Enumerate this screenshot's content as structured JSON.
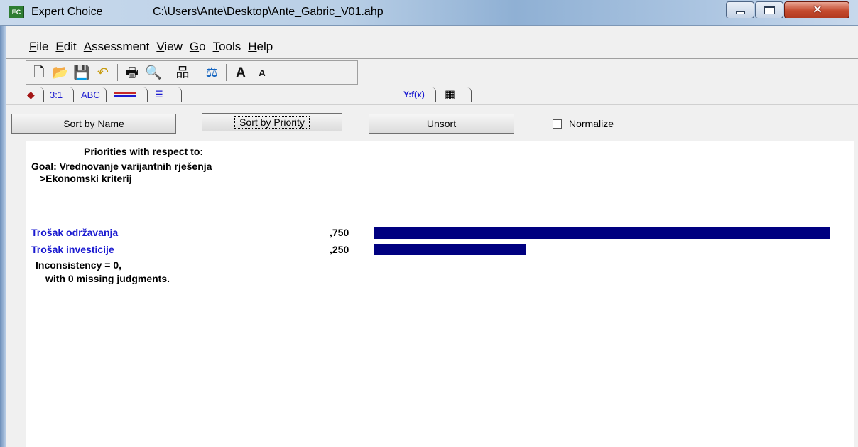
{
  "window": {
    "app_name": "Expert Choice",
    "file_path": "C:\\Users\\Ante\\Desktop\\Ante_Gabric_V01.ahp",
    "icon_text": "EC"
  },
  "menu": [
    "File",
    "Edit",
    "Assessment",
    "View",
    "Go",
    "Tools",
    "Help"
  ],
  "toolbar_icons": [
    "new-icon",
    "open-icon",
    "save-icon",
    "undo-icon",
    "print-icon",
    "print-preview-icon",
    "hierarchy-icon",
    "balance-icon",
    "font-larger-icon",
    "font-smaller-icon"
  ],
  "tabs": [
    "3:1",
    "ABC",
    "Y:f(x)"
  ],
  "buttons": {
    "sort_by_name": "Sort by Name",
    "sort_by_priority": "Sort by Priority",
    "unsort": "Unsort",
    "normalize": "Normalize"
  },
  "report": {
    "heading": "Priorities with respect to:",
    "goal": "Goal: Vrednovanje varijantnih rješenja",
    "node": ">Ekonomski kriterij",
    "items": [
      {
        "label": "Trošak održavanja",
        "value_text": ",750",
        "value": 0.75
      },
      {
        "label": "Trošak investicije",
        "value_text": ",250",
        "value": 0.25
      }
    ],
    "inconsistency": "Inconsistency = 0,",
    "missing": "with 0  missing judgments."
  },
  "colors": {
    "bar": "#000080",
    "item_label": "#1a1ad0"
  }
}
